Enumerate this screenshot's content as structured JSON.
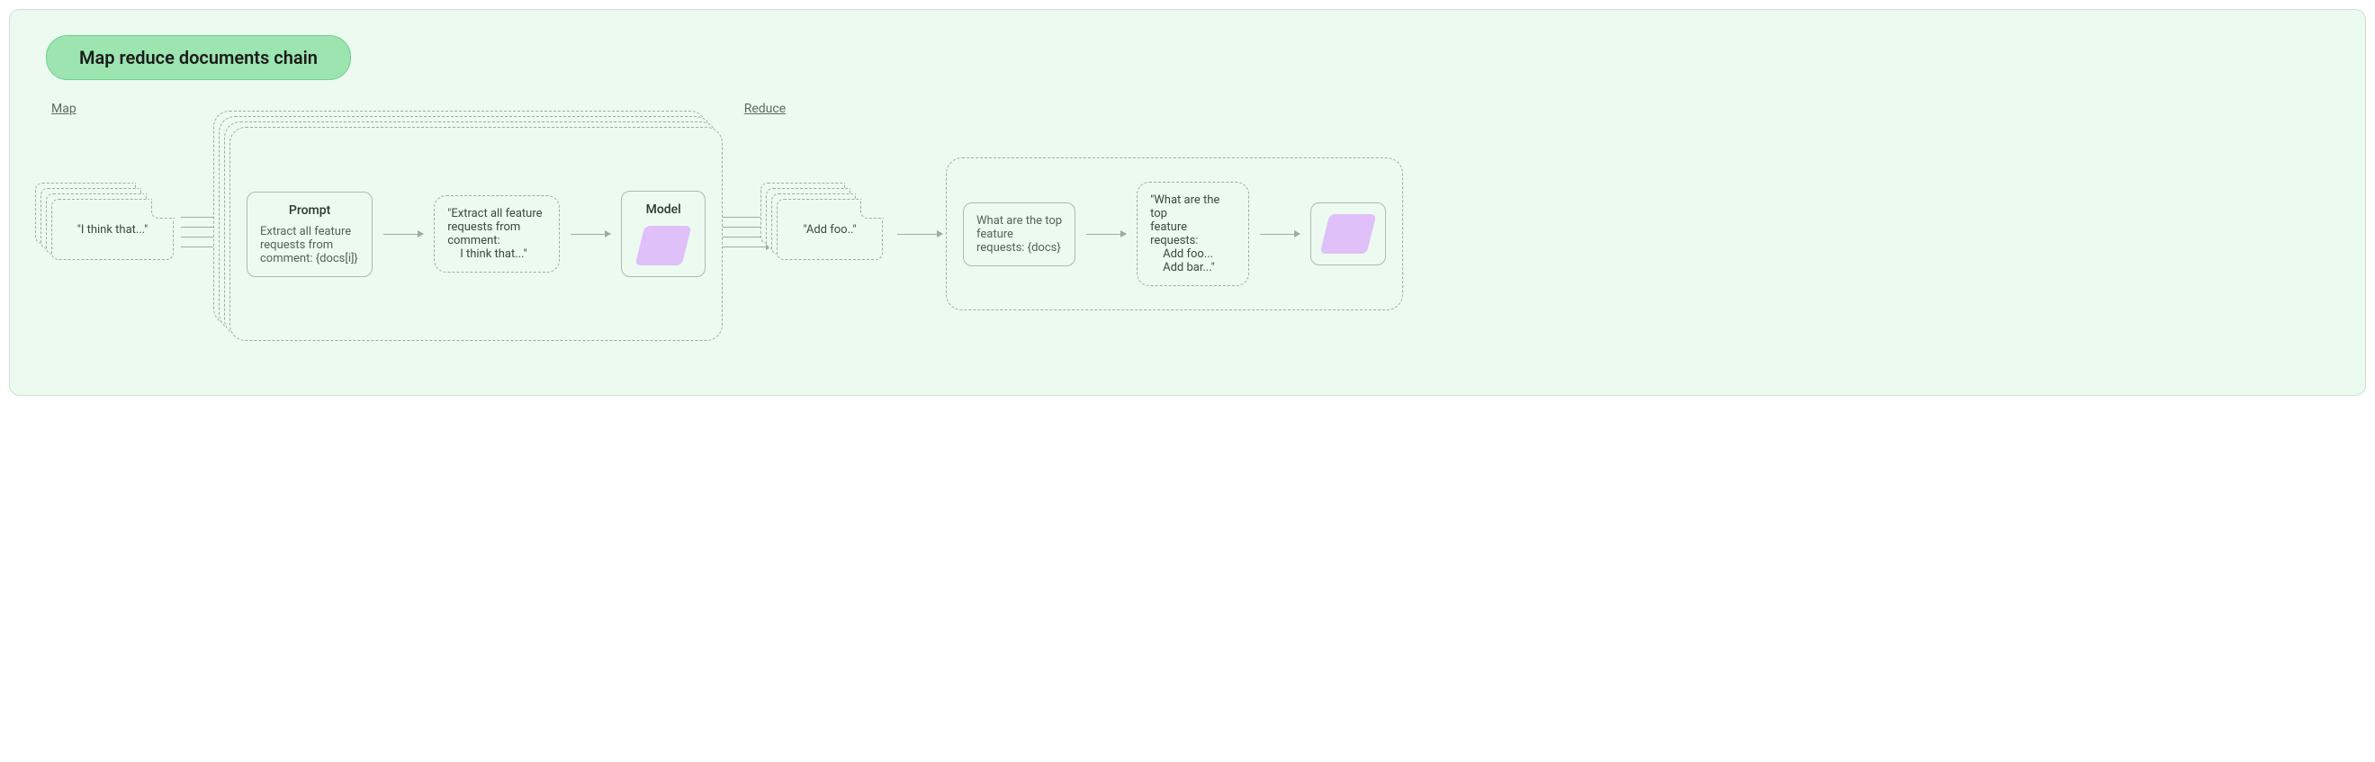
{
  "title": "Map reduce documents chain",
  "sections": {
    "map": "Map",
    "reduce": "Reduce"
  },
  "map": {
    "input_doc": "\"I think that...\"",
    "prompt": {
      "header": "Prompt",
      "body": "Extract all feature requests from comment: {docs[i]}"
    },
    "formatted": {
      "line1": "\"Extract all feature",
      "line2": "requests from",
      "line3": "comment:",
      "line4": "I think that...\""
    },
    "model": {
      "header": "Model"
    },
    "output_doc": "\"Add foo..\""
  },
  "reduce": {
    "prompt": {
      "body": "What are the top feature requests: {docs}"
    },
    "formatted": {
      "line1": "\"What are the top",
      "line2": "feature requests:",
      "line3": "Add foo...",
      "line4": "Add bar...\""
    }
  }
}
